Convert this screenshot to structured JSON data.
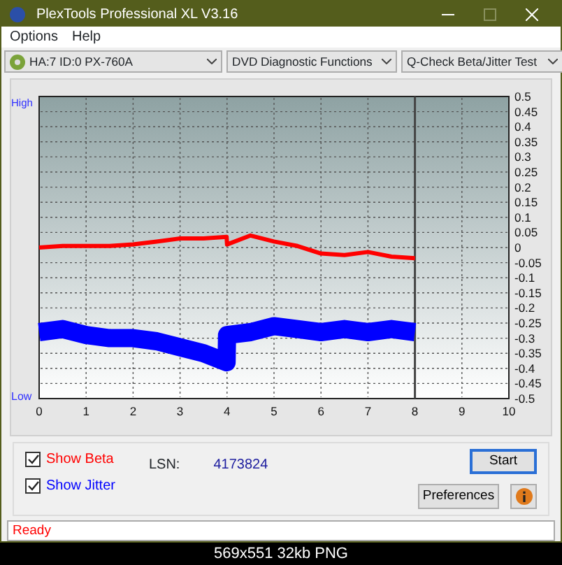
{
  "window": {
    "title": "PlexTools Professional XL V3.16"
  },
  "menu": [
    "Options",
    "Help"
  ],
  "selectors": [
    {
      "kind": "drive",
      "value": "HA:7 ID:0  PX-760A"
    },
    {
      "kind": "plain",
      "value": "DVD Diagnostic Functions"
    },
    {
      "kind": "plain",
      "value": "Q-Check Beta/Jitter Test"
    }
  ],
  "chart": {
    "high_label": "High",
    "low_label": "Low",
    "chart_data": {
      "type": "line",
      "x": [
        0,
        0.5,
        1,
        1.5,
        2,
        2.5,
        3,
        3.5,
        3.99,
        4,
        4.5,
        5,
        5.5,
        6,
        6.5,
        7,
        7.5,
        8
      ],
      "grid": true,
      "series": [
        {
          "color": "#ff0000",
          "values": [
            0,
            0.005,
            0.005,
            0.005,
            0.01,
            0.02,
            0.03,
            0.03,
            0.035,
            0.01,
            0.04,
            0.02,
            0.005,
            -0.02,
            -0.025,
            -0.015,
            -0.03,
            -0.035
          ]
        },
        {
          "color": "#0000ff",
          "values": [
            -0.28,
            -0.27,
            -0.29,
            -0.3,
            -0.3,
            -0.31,
            -0.33,
            -0.35,
            -0.38,
            -0.29,
            -0.28,
            -0.26,
            -0.27,
            -0.28,
            -0.27,
            -0.28,
            -0.27,
            -0.28
          ]
        }
      ],
      "xlim": [
        0,
        10
      ],
      "ylim": [
        -0.5,
        0.5
      ],
      "xticks": [
        0,
        1,
        2,
        3,
        4,
        5,
        6,
        7,
        8,
        9,
        10
      ],
      "yticks": [
        0.5,
        0.45,
        0.4,
        0.35,
        0.3,
        0.25,
        0.2,
        0.15,
        0.1,
        0.05,
        0,
        -0.05,
        -0.1,
        -0.15,
        -0.2,
        -0.25,
        -0.3,
        -0.35,
        -0.4,
        -0.45,
        -0.5
      ],
      "ref_lines": [
        {
          "axis": "x",
          "value": 8
        }
      ]
    }
  },
  "options": [
    {
      "label": "Show Beta",
      "checked": true,
      "color": "#ff0000"
    },
    {
      "label": "Show Jitter",
      "checked": true,
      "color": "#0000ff"
    }
  ],
  "lsn": {
    "label": "LSN:",
    "value": "4173824"
  },
  "buttons": {
    "start": "Start",
    "preferences": "Preferences"
  },
  "status": "Ready",
  "caption": "569x551 32kb PNG"
}
